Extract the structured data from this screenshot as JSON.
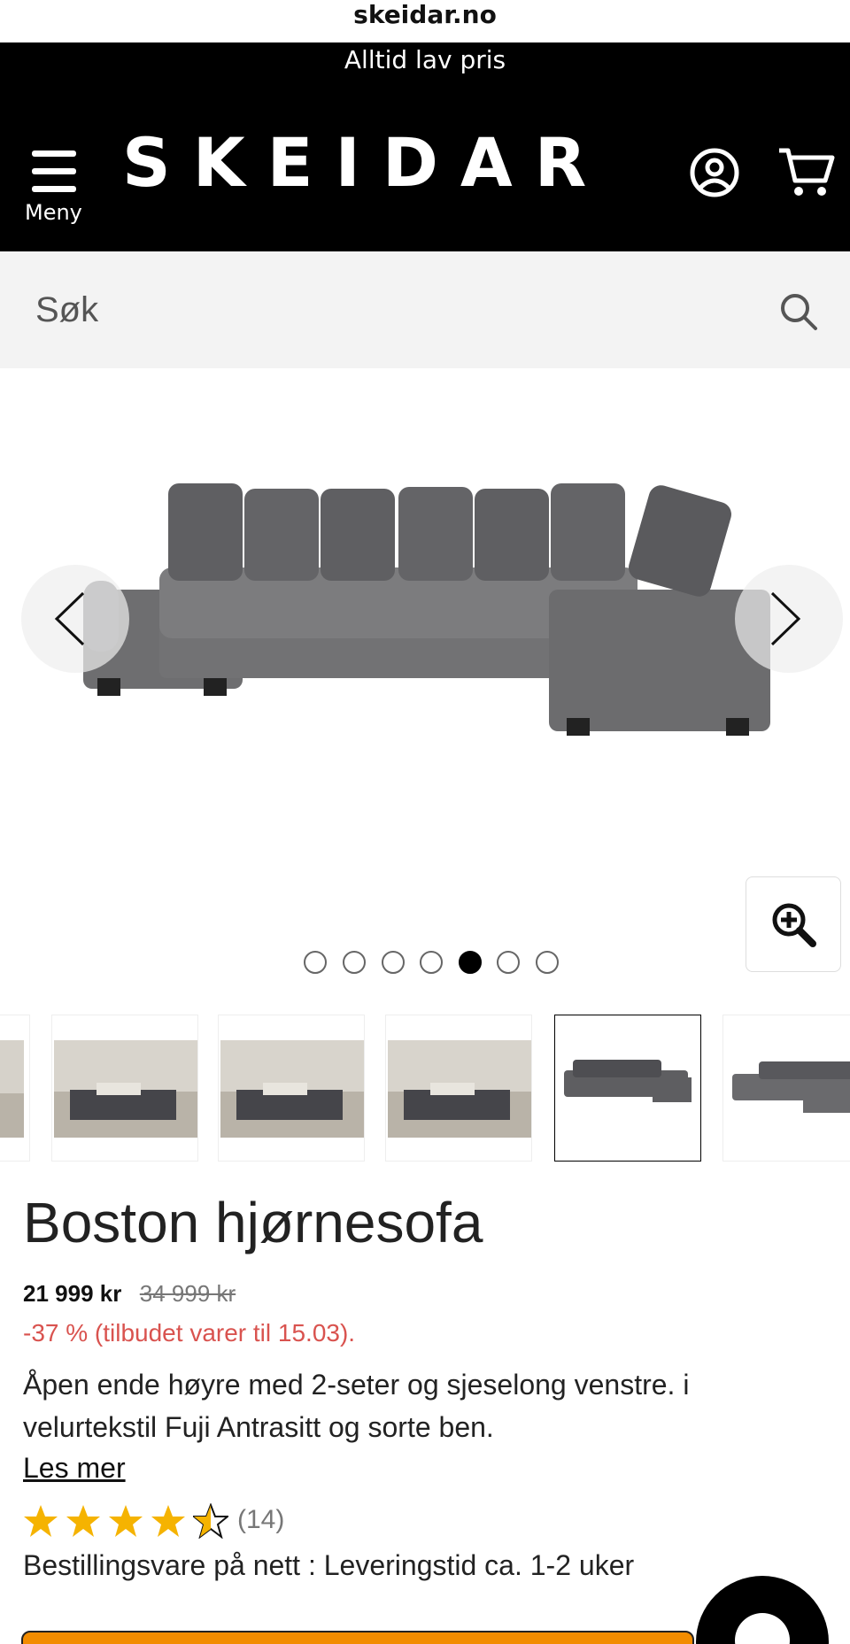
{
  "browser": {
    "url": "skeidar.no"
  },
  "promo": {
    "text": "Alltid lav pris"
  },
  "header": {
    "menu_label": "Meny",
    "logo": "SKEIDAR",
    "icons": [
      "hamburger-icon",
      "account-icon",
      "cart-icon"
    ]
  },
  "search": {
    "placeholder": "Søk",
    "icon": "search-icon"
  },
  "gallery": {
    "total_images": 7,
    "active_index": 4,
    "thumbnails": [
      "lifestyle",
      "lifestyle",
      "lifestyle",
      "lifestyle",
      "product",
      "product"
    ]
  },
  "product": {
    "title": "Boston hjørnesofa",
    "price": "21 999 kr",
    "old_price": "34 999 kr",
    "discount": "-37 % (tilbudet varer til 15.03).",
    "description": "Åpen ende høyre med 2-seter og sjeselong venstre. i velurtekstil Fuji Antrasitt og sorte ben.",
    "read_more": "Les mer",
    "rating": 4.5,
    "review_count": "(14)",
    "delivery": "Bestillingsvare på nett : Leveringstid ca. 1-2 uker"
  },
  "colors": {
    "accent": "#f28c00",
    "discount": "#d9534f",
    "star": "#f5b301",
    "header_bg": "#000000"
  }
}
